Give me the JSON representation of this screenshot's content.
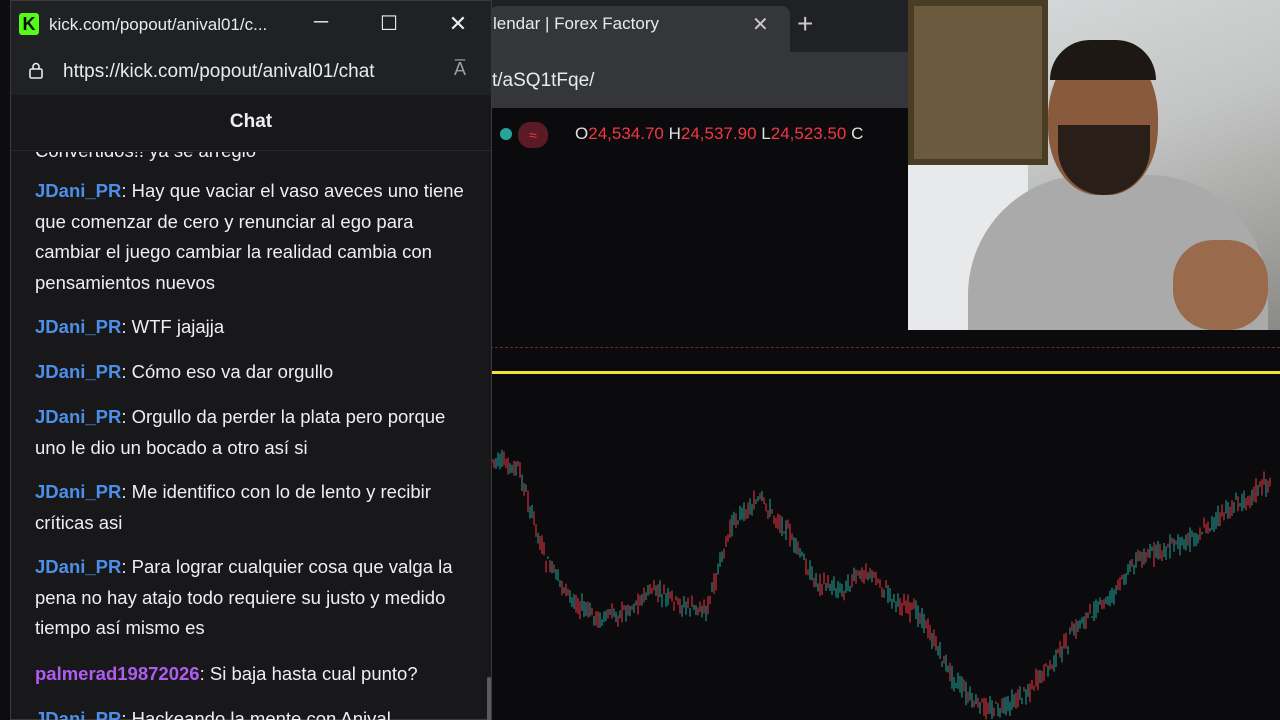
{
  "background_browser": {
    "tab_title": "lendar | Forex Factory",
    "url_fragment": "t/aSQ1tFqe/",
    "icons": [
      "close-icon",
      "plus-icon"
    ]
  },
  "chart_ohlc": {
    "o_label": "O",
    "o_value": "24,534.70",
    "h_label": "H",
    "h_value": "24,537.90",
    "l_label": "L",
    "l_value": "24,523.50",
    "c_label": "C",
    "pill_symbol": "≈"
  },
  "chart_colors": {
    "up": "#26a69a",
    "down": "#f23645",
    "level_line": "#f5e13a"
  },
  "popout": {
    "window_title": "kick.com/popout/anival01/c...",
    "url": "https://kick.com/popout/anival01/chat",
    "chat_title": "Chat",
    "brand_color": "#53fc18",
    "logo_letter": "K",
    "read_aloud": "A̅"
  },
  "messages": [
    {
      "user": "",
      "text": "Convertidos!! ya se arreglo"
    },
    {
      "user": "JDani_PR",
      "color": "blue",
      "text": "Hay que vaciar el vaso aveces uno tiene que comenzar de cero y renunciar al ego para cambiar el juego cambiar la realidad cambia con pensamientos nuevos"
    },
    {
      "user": "JDani_PR",
      "color": "blue",
      "text": "WTF jajajja"
    },
    {
      "user": "JDani_PR",
      "color": "blue",
      "text": "Cómo eso va dar orgullo"
    },
    {
      "user": "JDani_PR",
      "color": "blue",
      "text": "Orgullo da perder la plata pero porque uno le dio un bocado a otro así si"
    },
    {
      "user": "JDani_PR",
      "color": "blue",
      "text": "Me identifico con lo de lento y recibir críticas asi"
    },
    {
      "user": "JDani_PR",
      "color": "blue",
      "text": "Para lograr cualquier cosa que valga la pena no hay atajo todo requiere su justo y medido tiempo así mismo es"
    },
    {
      "user": "palmerad19872026",
      "color": "purple",
      "text": "Si baja hasta cual punto?"
    },
    {
      "user": "JDani_PR",
      "color": "blue",
      "text": "Hackeando la mente con Anival"
    }
  ]
}
